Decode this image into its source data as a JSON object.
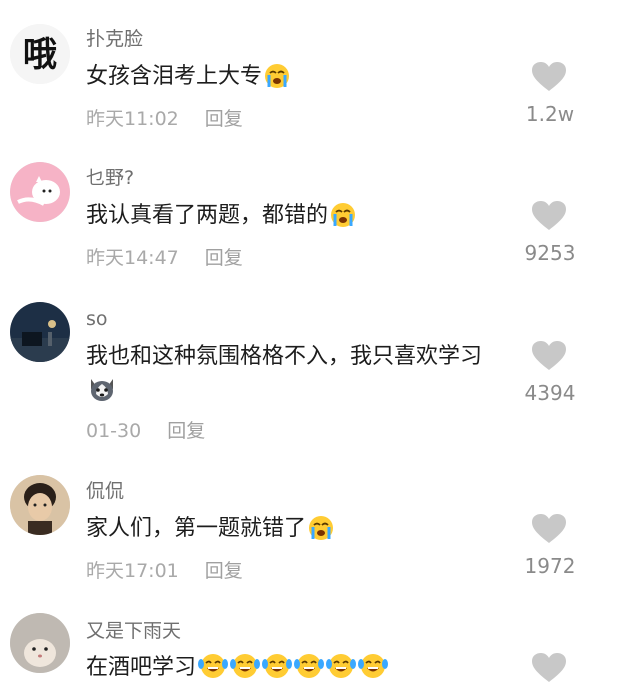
{
  "comments": [
    {
      "username": "扑克脸",
      "text": "女孩含泪考上大专",
      "time": "昨天11:02",
      "reply": "回复",
      "likes": "1.2w",
      "avatar_icon": "hanzi-e-avatar",
      "emoji": [
        "crying-face-emoji"
      ]
    },
    {
      "username": "乜野?",
      "text": "我认真看了两题，都错的",
      "time": "昨天14:47",
      "reply": "回复",
      "likes": "9253",
      "avatar_icon": "pink-cartoon-avatar",
      "emoji": [
        "crying-face-emoji"
      ]
    },
    {
      "username": "so",
      "text": "我也和这种氛围格格不入，我只喜欢学习",
      "time": "01-30",
      "reply": "回复",
      "likes": "4394",
      "avatar_icon": "dark-room-avatar",
      "emoji": [
        "husky-dog-emoji"
      ]
    },
    {
      "username": "侃侃",
      "text": "家人们，第一题就错了",
      "time": "昨天17:01",
      "reply": "回复",
      "likes": "1972",
      "avatar_icon": "person-photo-avatar",
      "emoji": [
        "crying-face-emoji"
      ]
    },
    {
      "username": "又是下雨天",
      "text": "在酒吧学习",
      "time": "",
      "reply": "",
      "likes": "",
      "avatar_icon": "hamster-avatar",
      "emoji": [
        "laughing-tears-emoji",
        "laughing-tears-emoji",
        "laughing-tears-emoji",
        "laughing-tears-emoji",
        "laughing-tears-emoji",
        "laughing-tears-emoji"
      ]
    }
  ],
  "colors": {
    "heart": "#c8c8c8",
    "username": "#6f6f6f",
    "meta": "#a9a9a9",
    "text": "#1d1d1d"
  }
}
